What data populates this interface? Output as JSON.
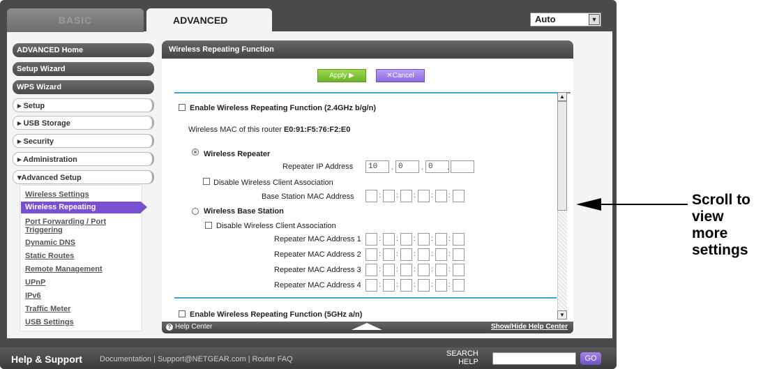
{
  "tabs": {
    "basic": "BASIC",
    "advanced": "ADVANCED"
  },
  "language_select": "Auto",
  "sidebar": {
    "main_items": [
      "ADVANCED Home",
      "Setup Wizard",
      "WPS Wizard"
    ],
    "sections": [
      "▸ Setup",
      "▸ USB Storage",
      "▸ Security",
      "▸ Administration",
      "▾Advanced Setup"
    ],
    "sub_items": [
      "Wireless Settings",
      "Wireless Repeating",
      "Port Forwarding / Port Triggering",
      "Dynamic DNS",
      "Static Routes",
      "Remote Management",
      "UPnP",
      "IPv6",
      "Traffic Meter",
      "USB Settings"
    ],
    "sub_link_labels": [
      "Wireless Settings",
      "Port Forwarding / Port",
      "Triggering",
      "Dynamic DNS",
      "Static Routes",
      "Remote Management",
      "UPnP",
      "IPv6",
      "Traffic Meter",
      "USB Settings"
    ],
    "active_item": "Wireless Repeating"
  },
  "panel": {
    "title": "Wireless Repeating Function",
    "apply_label": "Apply ▶",
    "cancel_label": "✕Cancel",
    "enable_24": "Enable Wireless Repeating Function (2.4GHz b/g/n)",
    "mac_label": "Wireless MAC of this router",
    "mac_value": "E0:91:F5:76:F2:E0",
    "repeater_label": "Wireless Repeater",
    "repeater_ip_label": "Repeater IP Address",
    "repeater_ip": [
      "10",
      "0",
      "0",
      ""
    ],
    "disable_client_assoc": "Disable Wireless Client Association",
    "base_mac_label": "Base Station MAC Address",
    "base_station_label": "Wireless Base Station",
    "repeater_mac_labels": [
      "Repeater MAC Address 1",
      "Repeater MAC Address 2",
      "Repeater MAC Address 3",
      "Repeater MAC Address 4"
    ],
    "enable_5": "Enable Wireless Repeating Function (5GHz a/n)"
  },
  "help_bar": {
    "help_center": "Help Center",
    "toggle": "Show/Hide Help Center"
  },
  "footer": {
    "title": "Help & Support",
    "links": "Documentation | Support@NETGEAR.com | Router FAQ",
    "search_label": "SEARCH\nHELP",
    "go_label": "GO"
  },
  "callout": "Scroll to\nview\nmore\nsettings",
  "colors": {
    "accent_purple": "#7b4fd2",
    "apply_green": "#6bb52a",
    "divider_blue": "#3aa6d8"
  }
}
